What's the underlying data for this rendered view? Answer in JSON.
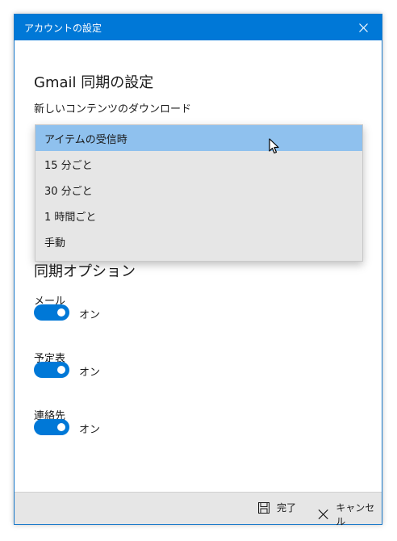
{
  "window": {
    "title": "アカウントの設定"
  },
  "heading": "Gmail 同期の設定",
  "download": {
    "label": "新しいコンテンツのダウンロード",
    "options": [
      "アイテムの受信時",
      "15 分ごと",
      "30 分ごと",
      "1 時間ごと",
      "手動"
    ],
    "selected": "アイテムの受信時"
  },
  "sync": {
    "heading": "同期オプション",
    "mail": {
      "label": "メール",
      "state": "オン"
    },
    "calendar": {
      "label": "予定表",
      "state": "オン"
    },
    "contacts": {
      "label": "連絡先",
      "state": "オン"
    }
  },
  "footer": {
    "done_label": "完了",
    "cancel_label": "キャンセル"
  },
  "colors": {
    "accent": "#0078d7",
    "selected_option": "#8fc1ee"
  }
}
